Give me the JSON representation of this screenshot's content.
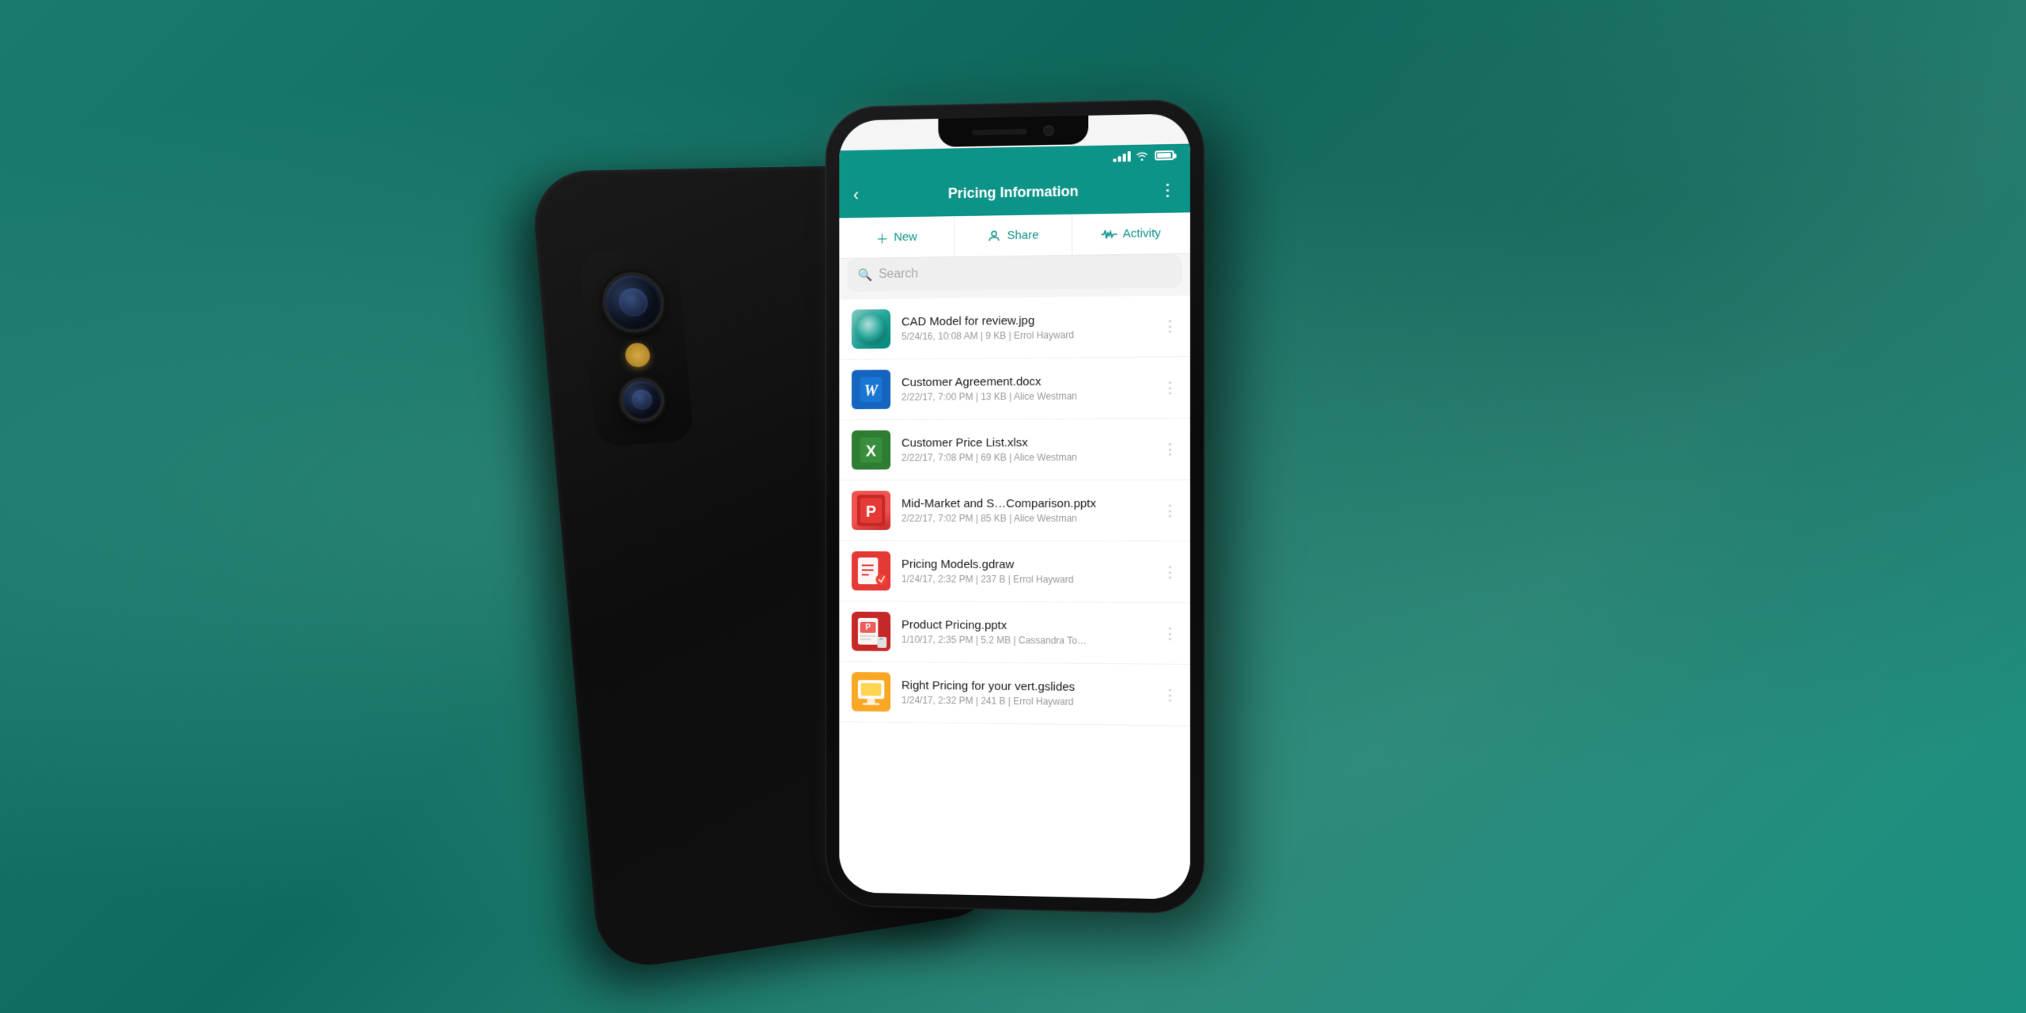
{
  "background": {
    "color_start": "#1a7a6e",
    "color_end": "#0d6b5e"
  },
  "header": {
    "title": "Pricing Information",
    "back_label": "‹",
    "more_label": "⋮"
  },
  "tabs": [
    {
      "id": "new",
      "label": "New",
      "icon": "plus"
    },
    {
      "id": "share",
      "label": "Share",
      "icon": "person"
    },
    {
      "id": "activity",
      "label": "Activity",
      "icon": "wave"
    }
  ],
  "search": {
    "placeholder": "Search"
  },
  "files": [
    {
      "name": "CAD Model for review.jpg",
      "meta": "5/24/16, 10:08 AM | 9 KB | Errol Hayward",
      "type": "jpg",
      "icon_type": "cad"
    },
    {
      "name": "Customer Agreement.docx",
      "meta": "2/22/17, 7:00 PM | 13 KB | Alice Westman",
      "type": "docx",
      "icon_type": "word"
    },
    {
      "name": "Customer Price List.xlsx",
      "meta": "2/22/17, 7:08 PM | 69 KB | Alice Westman",
      "type": "xlsx",
      "icon_type": "excel"
    },
    {
      "name": "Mid-Market and S…Comparison.pptx",
      "meta": "2/22/17, 7:02 PM | 85 KB | Alice Westman",
      "type": "pptx",
      "icon_type": "ppt"
    },
    {
      "name": "Pricing Models.gdraw",
      "meta": "1/24/17, 2:32 PM | 237 B | Errol Hayward",
      "type": "gdraw",
      "icon_type": "gdraw"
    },
    {
      "name": "Product Pricing.pptx",
      "meta": "1/10/17, 2:35 PM | 5.2 MB | Cassandra To…",
      "type": "pptx",
      "icon_type": "ppt2",
      "has_attachment": true
    },
    {
      "name": "Right Pricing for your vert.gslides",
      "meta": "1/24/17, 2:32 PM | 241 B | Errol Hayward",
      "type": "gslides",
      "icon_type": "gslides"
    }
  ],
  "status_bar": {
    "signal": "●●●●",
    "wifi": "wifi",
    "battery": "100"
  }
}
